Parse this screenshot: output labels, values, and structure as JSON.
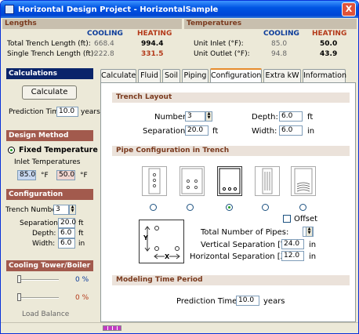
{
  "window": {
    "title": "Horizontal Design Project - HorizontalSample",
    "close_label": "X"
  },
  "lengths": {
    "header": "Lengths",
    "cooling_label": "COOLING",
    "heating_label": "HEATING",
    "rows": [
      {
        "label": "Total Trench Length (ft):",
        "cooling": "668.4",
        "heating": "994.4"
      },
      {
        "label": "Single Trench Length (ft):",
        "cooling": "222.8",
        "heating": "331.5"
      }
    ]
  },
  "temperatures": {
    "header": "Temperatures",
    "cooling_label": "COOLING",
    "heating_label": "HEATING",
    "rows": [
      {
        "label": "Unit Inlet (°F):",
        "cooling": "85.0",
        "heating": "50.0"
      },
      {
        "label": "Unit Outlet (°F):",
        "cooling": "94.8",
        "heating": "43.9"
      }
    ]
  },
  "sidebar": {
    "calculations_header": "Calculations",
    "calculate_button": "Calculate",
    "prediction_time_label": "Prediction Time:",
    "prediction_time_value": "10.0",
    "prediction_time_unit": "years",
    "design_method_header": "Design Method",
    "fixed_temp_label": "Fixed Temperature",
    "inlet_temps_label": "Inlet Temperatures",
    "inlet_cool": "85.0",
    "inlet_heat": "50.0",
    "deg_f": "°F",
    "configuration_header": "Configuration",
    "trench_number_label": "Trench Number:",
    "trench_number_value": "3",
    "separation_label": "Separation:",
    "separation_value": "20.0",
    "separation_unit": "ft",
    "depth_label": "Depth:",
    "depth_value": "6.0",
    "depth_unit": "ft",
    "width_label": "Width:",
    "width_value": "6.0",
    "width_unit": "in",
    "cooling_tower_header": "Cooling Tower/Boiler",
    "slider1_pct": "0 %",
    "slider2_pct": "0 %",
    "load_balance_label": "Load Balance"
  },
  "tabs": [
    {
      "label": "Calculate"
    },
    {
      "label": "Fluid"
    },
    {
      "label": "Soil"
    },
    {
      "label": "Piping"
    },
    {
      "label": "Configuration"
    },
    {
      "label": "Extra kW"
    },
    {
      "label": "Information"
    }
  ],
  "trench_layout": {
    "header": "Trench Layout",
    "number_label": "Number:",
    "number_value": "3",
    "separation_label": "Separation:",
    "separation_value": "20.0",
    "separation_unit": "ft",
    "depth_label": "Depth:",
    "depth_value": "6.0",
    "depth_unit": "ft",
    "width_label": "Width:",
    "width_value": "6.0",
    "width_unit": "in"
  },
  "pipe_config": {
    "header": "Pipe Configuration in Trench",
    "offset_label": "Offset",
    "total_pipes_label": "Total Number of Pipes:",
    "total_pipes_value": "",
    "vertical_sep_label": "Vertical Separation [Y]:",
    "vertical_sep_value": "24.0",
    "vertical_sep_unit": "in",
    "horizontal_sep_label": "Horizontal Separation [X]:",
    "horizontal_sep_value": "12.0",
    "horizontal_sep_unit": "in",
    "diagram_y_label": "Y",
    "diagram_x_label": "X"
  },
  "modeling": {
    "header": "Modeling Time Period",
    "prediction_time_label": "Prediction Time:",
    "prediction_time_value": "10.0",
    "prediction_time_unit": "years"
  },
  "colors": {
    "cooling": "#0b3b9a",
    "heating": "#b43a1a",
    "title_bar": "#0054e3",
    "section_header_bg": "#0a246a",
    "brown_header_bg": "#a25a4d"
  }
}
